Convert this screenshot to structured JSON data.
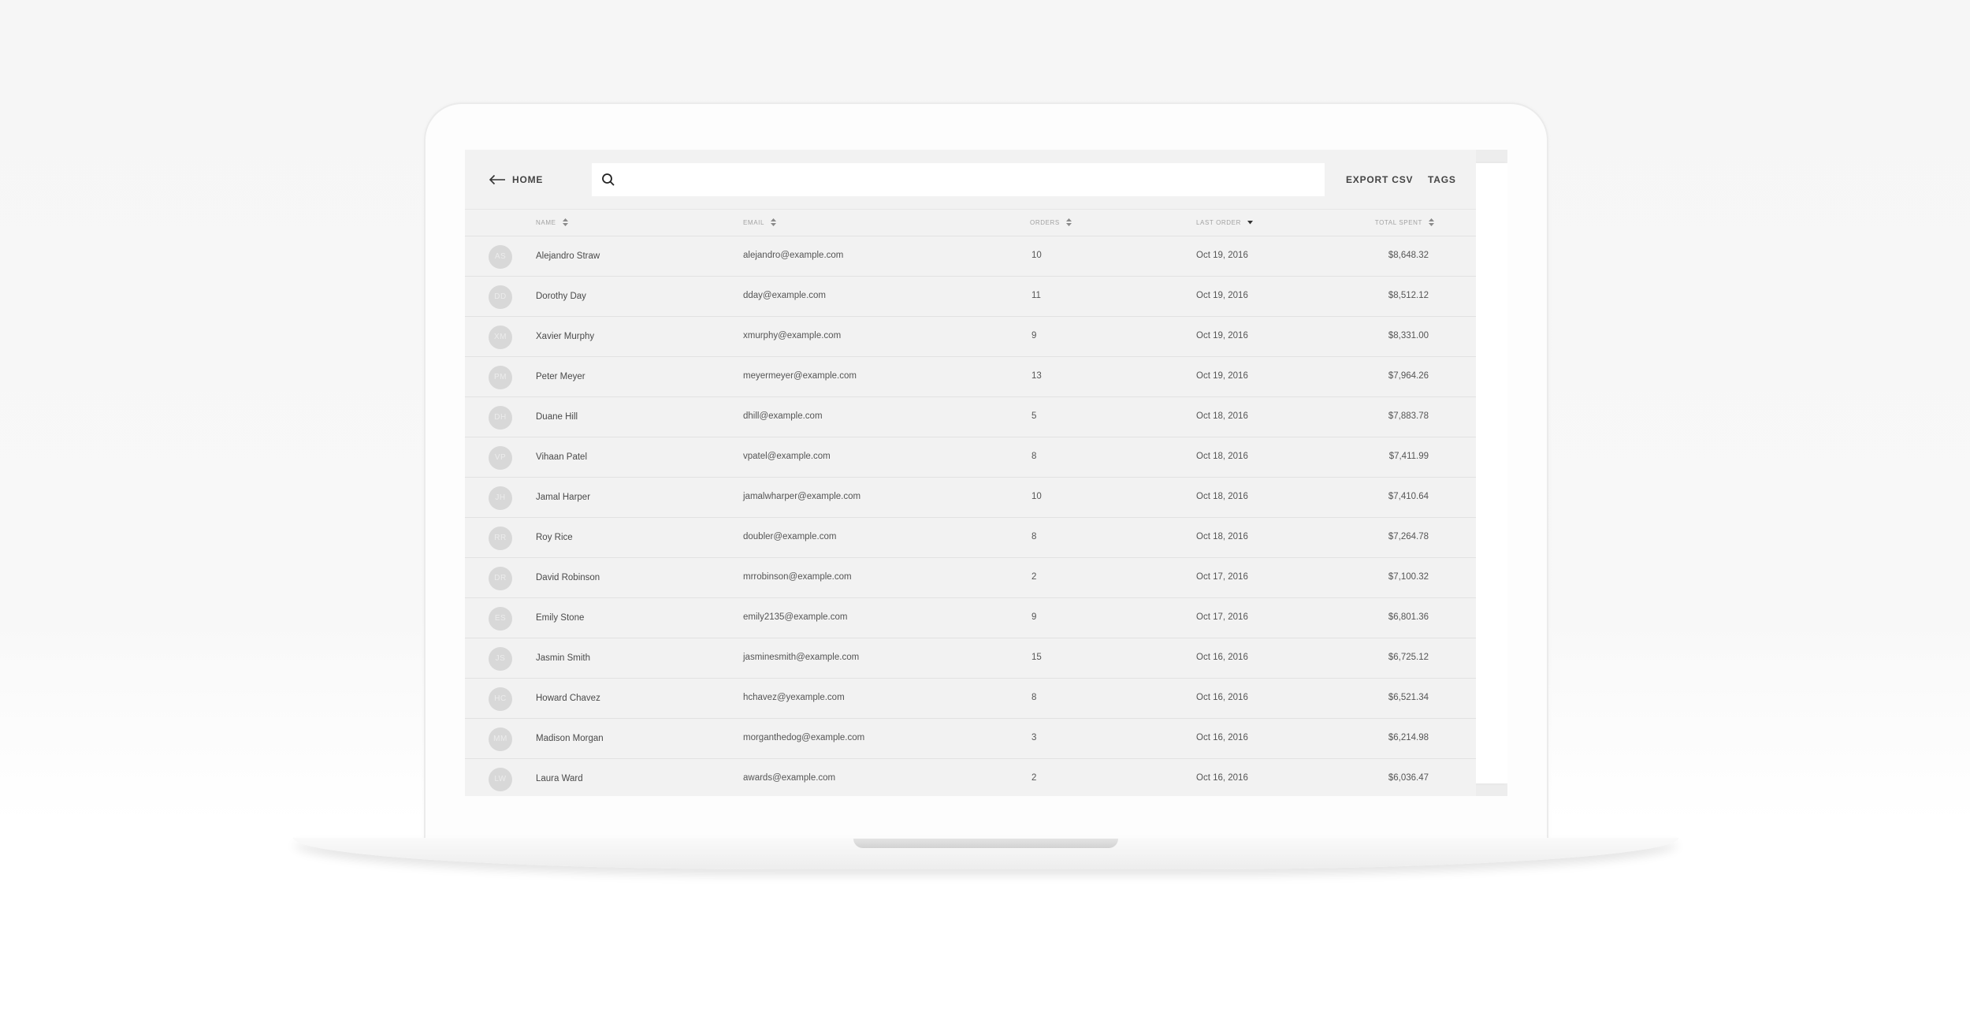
{
  "header": {
    "home_label": "HOME",
    "search_placeholder": "",
    "export_label": "EXPORT CSV",
    "tags_label": "TAGS"
  },
  "columns": {
    "name": "NAME",
    "email": "EMAIL",
    "orders": "ORDERS",
    "last_order": "LAST ORDER",
    "total_spent": "TOTAL SPENT"
  },
  "icons": {
    "back": "arrow-left-icon",
    "search": "search-icon",
    "sort": "sort-icon",
    "sort_desc": "caret-down-icon"
  },
  "customers": [
    {
      "initials": "AS",
      "name": "Alejandro Straw",
      "email": "alejandro@example.com",
      "orders": "10",
      "last_order": "Oct 19, 2016",
      "total": "$8,648.32"
    },
    {
      "initials": "DD",
      "name": "Dorothy Day",
      "email": "dday@example.com",
      "orders": "11",
      "last_order": "Oct 19, 2016",
      "total": "$8,512.12"
    },
    {
      "initials": "XM",
      "name": "Xavier Murphy",
      "email": "xmurphy@example.com",
      "orders": "9",
      "last_order": "Oct 19, 2016",
      "total": "$8,331.00"
    },
    {
      "initials": "PM",
      "name": "Peter Meyer",
      "email": "meyermeyer@example.com",
      "orders": "13",
      "last_order": "Oct 19, 2016",
      "total": "$7,964.26"
    },
    {
      "initials": "DH",
      "name": "Duane Hill",
      "email": "dhill@example.com",
      "orders": "5",
      "last_order": "Oct 18, 2016",
      "total": "$7,883.78"
    },
    {
      "initials": "VP",
      "name": "Vihaan Patel",
      "email": "vpatel@example.com",
      "orders": "8",
      "last_order": "Oct 18, 2016",
      "total": "$7,411.99"
    },
    {
      "initials": "JH",
      "name": "Jamal Harper",
      "email": "jamalwharper@example.com",
      "orders": "10",
      "last_order": "Oct 18, 2016",
      "total": "$7,410.64"
    },
    {
      "initials": "RR",
      "name": "Roy Rice",
      "email": "doubler@example.com",
      "orders": "8",
      "last_order": "Oct 18, 2016",
      "total": "$7,264.78"
    },
    {
      "initials": "DR",
      "name": "David Robinson",
      "email": "mrrobinson@example.com",
      "orders": "2",
      "last_order": "Oct 17, 2016",
      "total": "$7,100.32"
    },
    {
      "initials": "ES",
      "name": "Emily Stone",
      "email": "emily2135@example.com",
      "orders": "9",
      "last_order": "Oct 17, 2016",
      "total": "$6,801.36"
    },
    {
      "initials": "JS",
      "name": "Jasmin Smith",
      "email": "jasminesmith@example.com",
      "orders": "15",
      "last_order": "Oct 16, 2016",
      "total": "$6,725.12"
    },
    {
      "initials": "HC",
      "name": "Howard Chavez",
      "email": "hchavez@yexample.com",
      "orders": "8",
      "last_order": "Oct 16, 2016",
      "total": "$6,521.34"
    },
    {
      "initials": "MM",
      "name": "Madison Morgan",
      "email": "morganthedog@example.com",
      "orders": "3",
      "last_order": "Oct 16, 2016",
      "total": "$6,214.98"
    },
    {
      "initials": "LW",
      "name": "Laura Ward",
      "email": "awards@example.com",
      "orders": "2",
      "last_order": "Oct 16, 2016",
      "total": "$6,036.47"
    }
  ]
}
